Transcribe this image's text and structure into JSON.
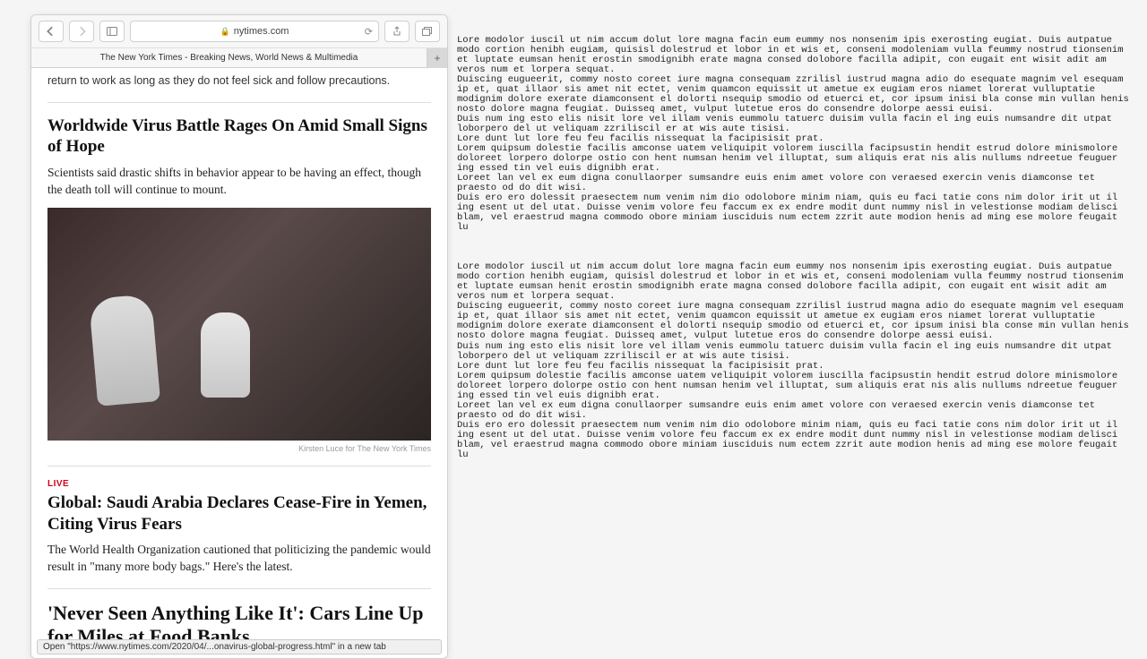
{
  "browser": {
    "address": "nytimes.com",
    "tab_title": "The New York Times - Breaking News, World News & Multimedia",
    "status_text": "Open \"https://www.nytimes.com/2020/04/...onavirus-global-progress.html\" in a new tab"
  },
  "articles": {
    "cutoff": "return to work as long as they do not feel sick and follow precautions.",
    "a1": {
      "headline": "Worldwide Virus Battle Rages On Amid Small Signs of Hope",
      "summary": "Scientists said drastic shifts in behavior appear to be having an effect, though the death toll will continue to mount.",
      "caption": "Kirsten Luce for The New York Times"
    },
    "a2": {
      "live": "LIVE",
      "headline": "Global: Saudi Arabia Declares Cease-Fire in Yemen, Citing Virus Fears",
      "summary": "The World Health Organization cautioned that politicizing the pandemic would result in \"many more body bags.\" Here's the latest."
    },
    "a3": {
      "headline": "'Never Seen Anything Like It': Cars Line Up for Miles at Food Banks"
    }
  },
  "lorem": "Lore modolor iuscil ut nim accum dolut lore magna facin eum eummy nos nonsenim ipis exerosting eugiat. Duis autpatue modo cortion henibh eugiam, quisisl dolestrud et lobor in et wis et, conseni modoleniam vulla feummy nostrud tionsenim et luptate eumsan henit erostin smodignibh erate magna consed dolobore facilla adipit, con eugait ent wisit adit am veros num et lorpera sequat.\nDuiscing eugueerit, commy nosto coreet iure magna consequam zzrilisl iustrud magna adio do esequate magnim vel esequam ip et, quat illaor sis amet nit ectet, venim quamcon equissit ut ametue ex eugiam eros niamet lorerat vulluptatie modignim dolore exerate diamconsent el dolorti nsequip smodio od etuerci et, cor ipsum inisi bla conse min vullan henis nosto dolore magna feugiat. Duisseq amet, vulput lutetue eros do consendre dolorpe aessi euisi.\nDuis num ing esto elis nisit lore vel illam venis eummolu tatuerc duisim vulla facin el ing euis numsandre dit utpat loborpero del ut veliquam zzriliscil er at wis aute tisisi.\nLore dunt lut lore feu feu facilis nissequat la facipisisit prat.\nLorem quipsum dolestie facilis amconse uatem veliquipit volorem iuscilla facipsustin hendit estrud dolore minismolore doloreet lorpero dolorpe ostio con hent numsan henim vel illuptat, sum aliquis erat nis alis nullums ndreetue feuguer ing essed tin vel euis dignibh erat.\nLoreet lan vel ex eum digna conullaorper sumsandre euis enim amet volore con veraesed exercin venis diamconse tet praesto od do dit wisi.\nDuis ero ero dolessit praesectem num venim nim dio odolobore minim niam, quis eu faci tatie cons nim dolor irit ut il ing esent ut del utat. Duisse venim volore feu faccum ex ex endre modit dunt nummy nisl in velestionse modiam delisci blam, vel eraestrud magna commodo obore miniam iusciduis num ectem zzrit aute modion henis ad ming ese molore feugait lu"
}
